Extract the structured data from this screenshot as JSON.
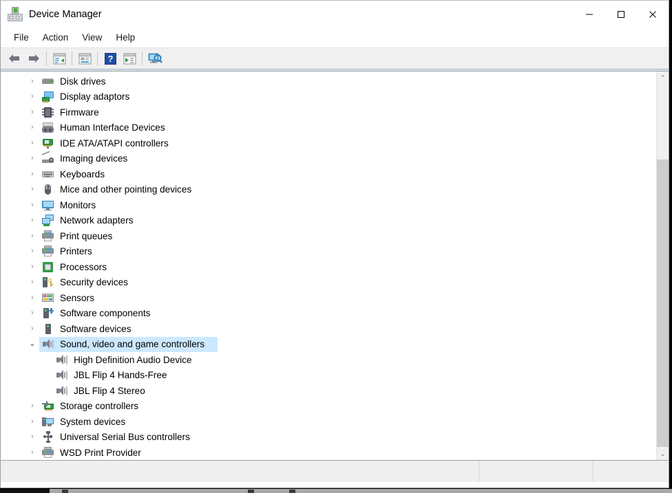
{
  "window": {
    "title": "Device Manager",
    "icon": "device-manager-icon",
    "controls": {
      "minimize": "—",
      "maximize": "☐",
      "close": "✕"
    }
  },
  "menubar": {
    "items": [
      "File",
      "Action",
      "View",
      "Help"
    ]
  },
  "toolbar": {
    "items": [
      {
        "name": "back-button",
        "icon": "back-arrow-icon"
      },
      {
        "name": "forward-button",
        "icon": "forward-arrow-icon"
      },
      {
        "name": "show-hide-console-tree-button",
        "icon": "console-tree-icon"
      },
      {
        "name": "properties-button",
        "icon": "properties-icon"
      },
      {
        "name": "help-button",
        "icon": "help-question-icon"
      },
      {
        "name": "update-driver-button",
        "icon": "update-driver-icon"
      },
      {
        "name": "scan-for-hardware-changes-button",
        "icon": "scan-hardware-icon"
      }
    ]
  },
  "tree": {
    "nodes": [
      {
        "label": "Disk drives",
        "icon": "disk-drive-icon",
        "state": "collapsed",
        "level": 1
      },
      {
        "label": "Display adaptors",
        "icon": "display-adapter-icon",
        "state": "collapsed",
        "level": 1
      },
      {
        "label": "Firmware",
        "icon": "firmware-icon",
        "state": "collapsed",
        "level": 1
      },
      {
        "label": "Human Interface Devices",
        "icon": "human-interface-device-icon",
        "state": "collapsed",
        "level": 1
      },
      {
        "label": "IDE ATA/ATAPI controllers",
        "icon": "ide-controller-icon",
        "state": "collapsed",
        "level": 1
      },
      {
        "label": "Imaging devices",
        "icon": "imaging-device-icon",
        "state": "collapsed",
        "level": 1
      },
      {
        "label": "Keyboards",
        "icon": "keyboard-icon",
        "state": "collapsed",
        "level": 1
      },
      {
        "label": "Mice and other pointing devices",
        "icon": "mouse-icon",
        "state": "collapsed",
        "level": 1
      },
      {
        "label": "Monitors",
        "icon": "monitor-icon",
        "state": "collapsed",
        "level": 1
      },
      {
        "label": "Network adapters",
        "icon": "network-adapter-icon",
        "state": "collapsed",
        "level": 1
      },
      {
        "label": "Print queues",
        "icon": "printer-icon",
        "state": "collapsed",
        "level": 1
      },
      {
        "label": "Printers",
        "icon": "printer-icon",
        "state": "collapsed",
        "level": 1
      },
      {
        "label": "Processors",
        "icon": "processor-icon",
        "state": "collapsed",
        "level": 1
      },
      {
        "label": "Security devices",
        "icon": "security-device-icon",
        "state": "collapsed",
        "level": 1
      },
      {
        "label": "Sensors",
        "icon": "sensor-icon",
        "state": "collapsed",
        "level": 1
      },
      {
        "label": "Software components",
        "icon": "software-component-icon",
        "state": "collapsed",
        "level": 1
      },
      {
        "label": "Software devices",
        "icon": "software-device-icon",
        "state": "collapsed",
        "level": 1
      },
      {
        "label": "Sound, video and game controllers",
        "icon": "speaker-icon",
        "state": "expanded",
        "level": 1,
        "selected": true
      },
      {
        "label": "High Definition Audio Device",
        "icon": "speaker-icon",
        "state": "leaf",
        "level": 2
      },
      {
        "label": "JBL Flip 4 Hands-Free",
        "icon": "speaker-icon",
        "state": "leaf",
        "level": 2
      },
      {
        "label": "JBL Flip 4 Stereo",
        "icon": "speaker-icon",
        "state": "leaf",
        "level": 2
      },
      {
        "label": "Storage controllers",
        "icon": "storage-controller-icon",
        "state": "collapsed",
        "level": 1
      },
      {
        "label": "System devices",
        "icon": "system-device-icon",
        "state": "collapsed",
        "level": 1
      },
      {
        "label": "Universal Serial Bus controllers",
        "icon": "usb-controller-icon",
        "state": "collapsed",
        "level": 1
      },
      {
        "label": "WSD Print Provider",
        "icon": "printer-icon",
        "state": "collapsed",
        "level": 1
      }
    ],
    "chevron_collapsed": "›",
    "chevron_expanded": "⌄",
    "selection_color": "#cce8ff"
  },
  "scrollbar": {
    "up_arrow": "⌃",
    "down_arrow": "⌄"
  },
  "statusbar": {
    "pane1": "",
    "pane2": "",
    "pane3": ""
  },
  "taskbar": {
    "text": ""
  }
}
